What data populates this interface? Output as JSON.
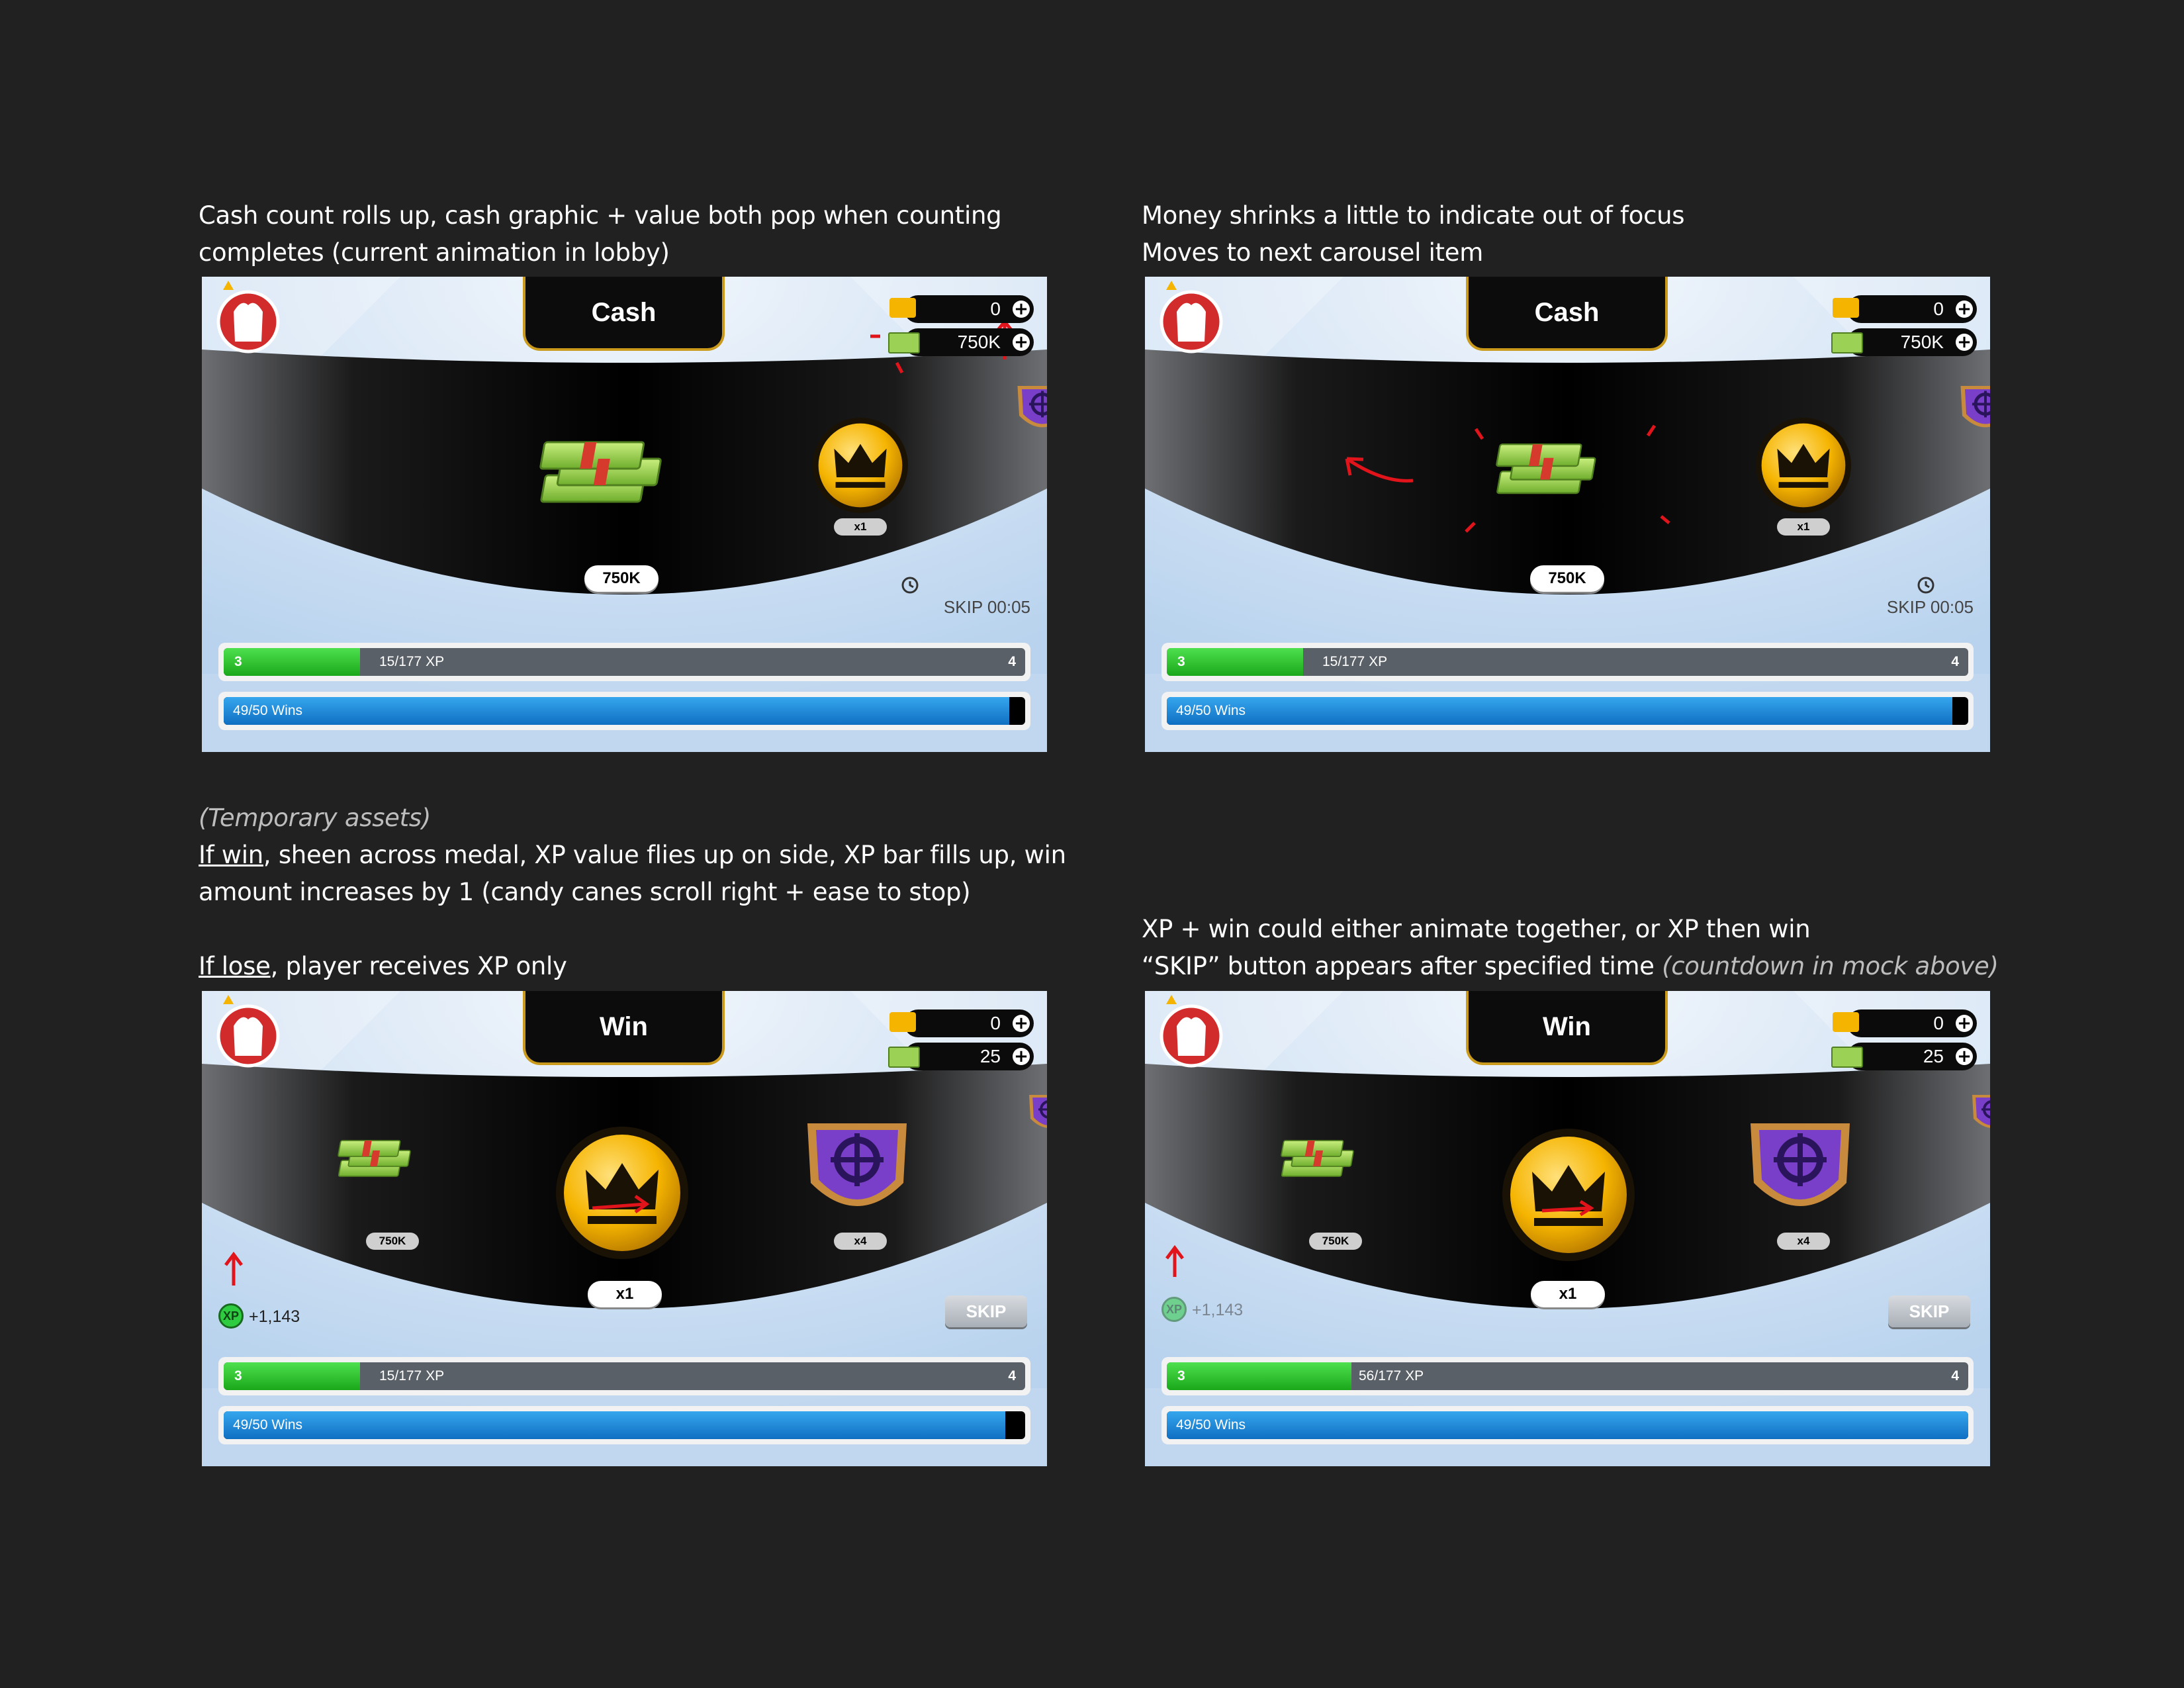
{
  "captions": {
    "p1": {
      "line1": "Cash count rolls up, cash graphic + value both pop when counting",
      "line2": "completes (current animation in lobby)"
    },
    "p2": {
      "line1": "Money shrinks a little to indicate out of focus",
      "line2": "Moves to next carousel item"
    },
    "p3": {
      "temp": "(Temporary assets)",
      "win_u": "If win",
      "win_rest": ", sheen across medal, XP value flies up on side, XP bar fills up, win",
      "win_line2": "amount increases by 1 (candy canes scroll right + ease to stop)",
      "lose_u": "If lose",
      "lose_rest": ", player receives XP only"
    },
    "p4": {
      "line1": "XP + win could either animate together, or XP then win",
      "line2_main": "“SKIP” button appears after specified time ",
      "line2_note": "(countdown in mock above)"
    }
  },
  "mocks": [
    {
      "title": "Cash",
      "gold": "0",
      "cash": "750K",
      "money_label": "750K",
      "crown_label": "x1",
      "skip_text": "SKIP 00:05",
      "xp_level": "3",
      "xp_next": "4",
      "xp_text": "15/177 XP",
      "xp_progress": 0.17,
      "wins_text": "49/50 Wins",
      "wins_progress": 0.98
    },
    {
      "title": "Cash",
      "gold": "0",
      "cash": "750K",
      "money_label": "750K",
      "crown_label": "x1",
      "skip_text": "SKIP 00:05",
      "xp_level": "3",
      "xp_next": "4",
      "xp_text": "15/177 XP",
      "xp_progress": 0.17,
      "wins_text": "49/50 Wins",
      "wins_progress": 0.98
    },
    {
      "title": "Win",
      "gold": "0",
      "cash": "25",
      "money_label": "750K",
      "crown_label": "x1",
      "shield_label": "x4",
      "skip_label": "SKIP",
      "xp_gain": "+1,143",
      "xp_badge": "XP",
      "xp_level": "3",
      "xp_next": "4",
      "xp_text": "15/177 XP",
      "xp_progress": 0.17,
      "wins_text": "49/50 Wins",
      "wins_progress": 0.975
    },
    {
      "title": "Win",
      "gold": "0",
      "cash": "25",
      "money_label": "750K",
      "crown_label": "x1",
      "shield_label": "x4",
      "skip_label": "SKIP",
      "xp_gain": "+1,143",
      "xp_badge": "XP",
      "xp_level": "3",
      "xp_next": "4",
      "xp_text": "56/177 XP",
      "xp_progress": 0.23,
      "wins_text": "49/50 Wins",
      "wins_progress": 1.0
    }
  ],
  "colors": {
    "annotation_red": "#e0141a",
    "xp_green": "#2ecc40",
    "wins_blue": "#1f8ad6",
    "gold": "#f5b400"
  }
}
